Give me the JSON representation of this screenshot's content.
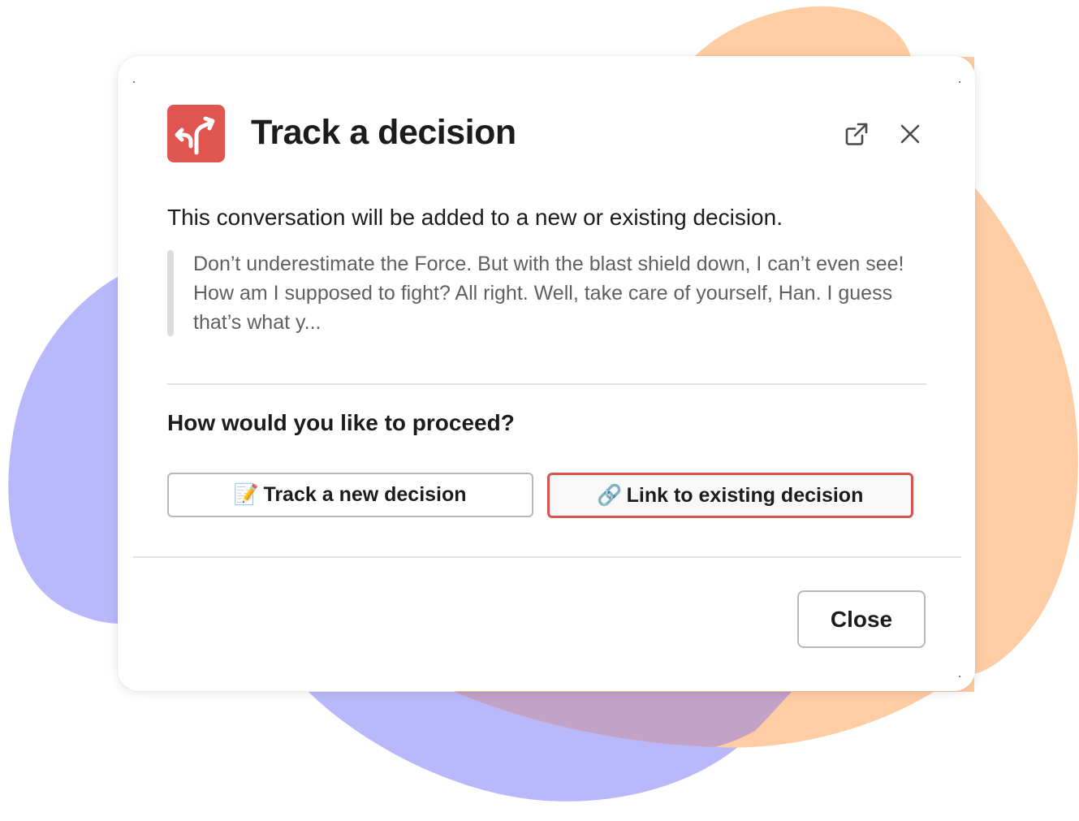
{
  "dialog": {
    "title": "Track a decision",
    "app_icon": "fork-arrows-icon",
    "header_actions": [
      "external-link-icon",
      "close-icon"
    ],
    "intro": "This conversation will be added to a new or existing decision.",
    "quote": "Don’t underestimate the Force. But with the blast shield down, I can’t even see! How am I supposed to fight? All right. Well, take care of yourself, Han. I guess that’s what y...",
    "question": "How would you like to proceed?",
    "buttons": {
      "track_new": {
        "emoji": "📝",
        "label": "Track a new decision"
      },
      "link_existing": {
        "emoji": "🔗",
        "label": "Link to existing decision"
      }
    },
    "close_label": "Close"
  },
  "colors": {
    "accent_red": "#e0554f",
    "blob_purple": "#b9b8fa",
    "blob_orange": "#ffcda3",
    "blob_overlap": "#c2a2c7"
  }
}
